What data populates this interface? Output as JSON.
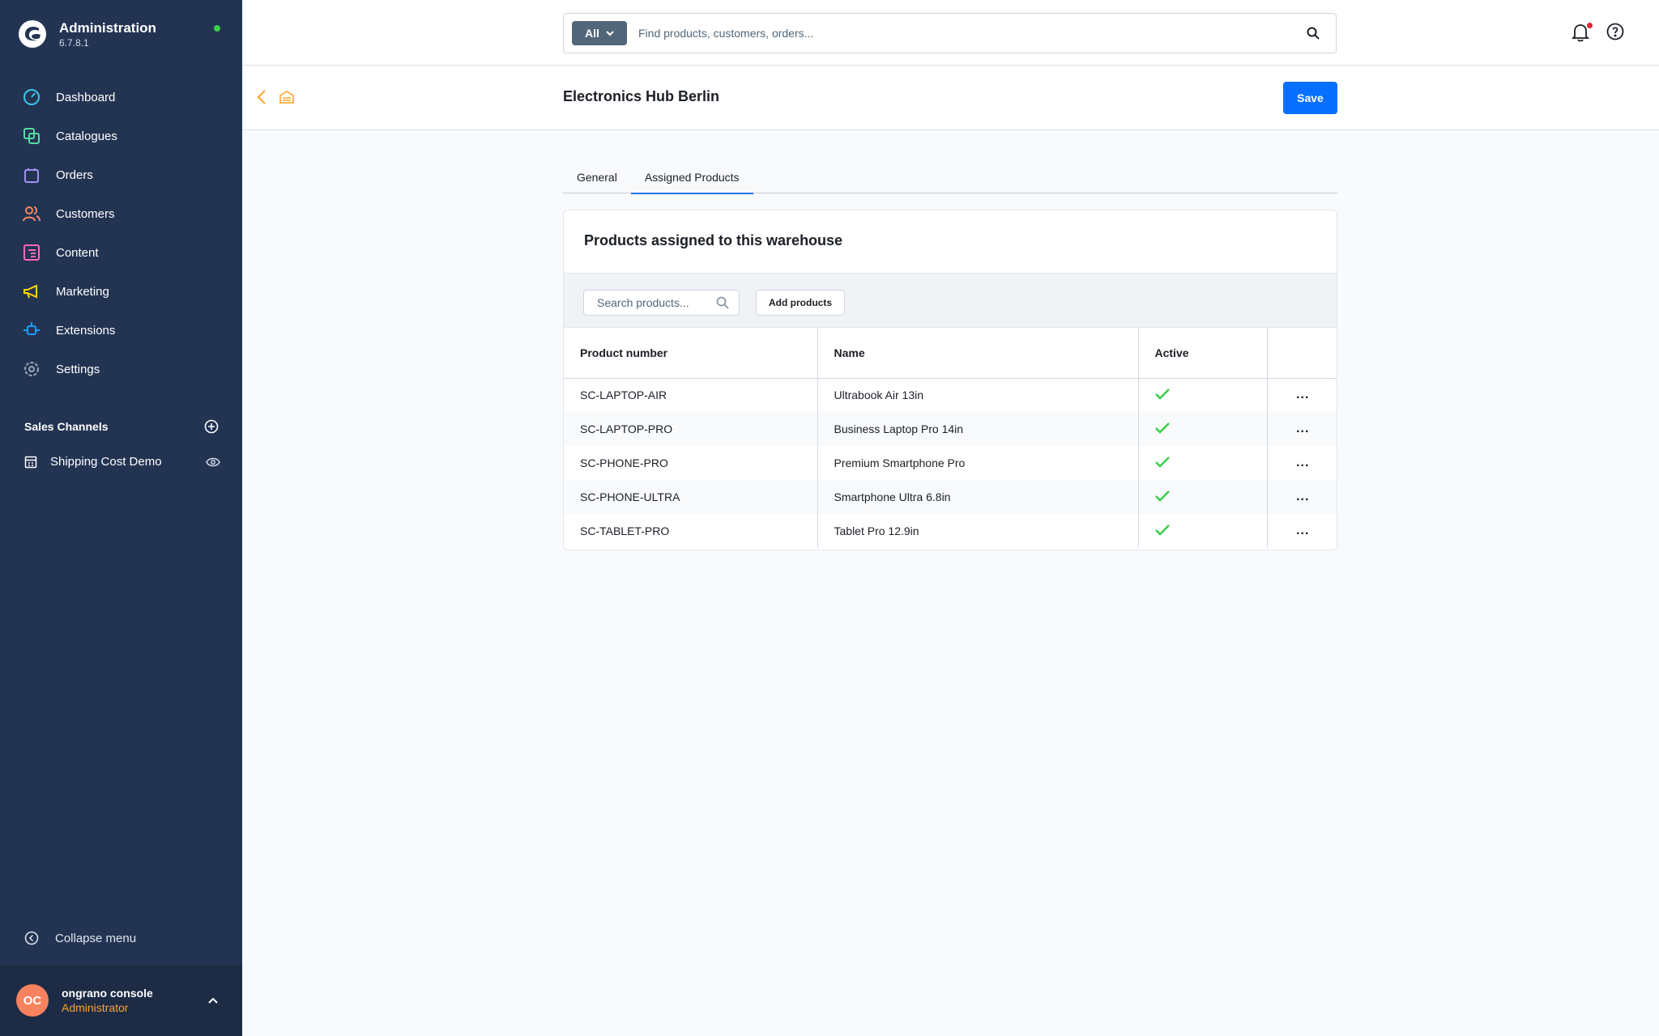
{
  "app": {
    "title": "Administration",
    "version": "6.7.8.1"
  },
  "sidebar": {
    "items": [
      {
        "label": "Dashboard",
        "icon": "dashboard-icon",
        "color": "#3ec5e9"
      },
      {
        "label": "Catalogues",
        "icon": "catalogues-icon",
        "color": "#57d9a3"
      },
      {
        "label": "Orders",
        "icon": "orders-icon",
        "color": "#a092f0"
      },
      {
        "label": "Customers",
        "icon": "customers-icon",
        "color": "#f88962"
      },
      {
        "label": "Content",
        "icon": "content-icon",
        "color": "#ff68b4"
      },
      {
        "label": "Marketing",
        "icon": "marketing-icon",
        "color": "#ffd700"
      },
      {
        "label": "Extensions",
        "icon": "extensions-icon",
        "color": "#189eff"
      },
      {
        "label": "Settings",
        "icon": "settings-icon",
        "color": "#9aa8b5"
      }
    ],
    "sales_channels_title": "Sales Channels",
    "sales_channel_item": "Shipping Cost Demo",
    "collapse_label": "Collapse menu"
  },
  "user": {
    "initials": "OC",
    "name": "ongrano console",
    "role": "Administrator"
  },
  "search": {
    "type_label": "All",
    "placeholder": "Find products, customers, orders..."
  },
  "page": {
    "title": "Electronics Hub Berlin",
    "save_label": "Save"
  },
  "tabs": [
    {
      "label": "General",
      "active": false
    },
    {
      "label": "Assigned Products",
      "active": true
    }
  ],
  "card": {
    "title": "Products assigned to this warehouse",
    "search_placeholder": "Search products...",
    "add_label": "Add products",
    "columns": [
      "Product number",
      "Name",
      "Active"
    ],
    "rows": [
      {
        "number": "SC-LAPTOP-AIR",
        "name": "Ultrabook Air 13in",
        "active": true
      },
      {
        "number": "SC-LAPTOP-PRO",
        "name": "Business Laptop Pro 14in",
        "active": true
      },
      {
        "number": "SC-PHONE-PRO",
        "name": "Premium Smartphone Pro",
        "active": true
      },
      {
        "number": "SC-PHONE-ULTRA",
        "name": "Smartphone Ultra 6.8in",
        "active": true
      },
      {
        "number": "SC-TABLET-PRO",
        "name": "Tablet Pro 12.9in",
        "active": true
      }
    ],
    "row_action_label": "..."
  },
  "colors": {
    "sidebar_bg": "#233453",
    "accent": "#0870ff",
    "check": "#37d046",
    "avatar": "#f9825e",
    "role": "#ffa227"
  }
}
